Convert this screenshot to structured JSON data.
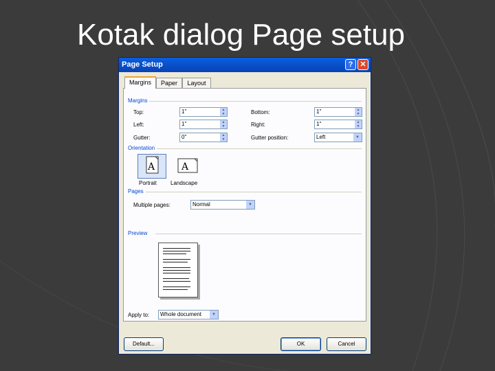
{
  "slide": {
    "title": "Kotak dialog Page setup"
  },
  "colors": {
    "accent": "#0046d5",
    "titlebar": "#0a5fe0",
    "close": "#d9492b",
    "background": "#3b3b3b"
  },
  "dialog": {
    "title": "Page Setup",
    "help_label": "?",
    "close_label": "✕",
    "tabs": [
      {
        "label": "Margins",
        "active": true
      },
      {
        "label": "Paper"
      },
      {
        "label": "Layout"
      }
    ],
    "margins": {
      "section": "Margins",
      "top_label": "Top:",
      "top_value": "1\"",
      "bottom_label": "Bottom:",
      "bottom_value": "1\"",
      "left_label": "Left:",
      "left_value": "1\"",
      "right_label": "Right:",
      "right_value": "1\"",
      "gutter_label": "Gutter:",
      "gutter_value": "0\"",
      "gutter_position_label": "Gutter position:",
      "gutter_position_value": "Left"
    },
    "orientation": {
      "section": "Orientation",
      "portrait_label": "Portrait",
      "landscape_label": "Landscape",
      "glyph": "A",
      "selected": "Portrait"
    },
    "pages": {
      "section": "Pages",
      "multiple_label": "Multiple pages:",
      "multiple_value": "Normal"
    },
    "preview": {
      "section": "Preview",
      "apply_label": "Apply to:",
      "apply_value": "Whole document"
    },
    "buttons": {
      "default": "Default...",
      "ok": "OK",
      "cancel": "Cancel"
    }
  }
}
